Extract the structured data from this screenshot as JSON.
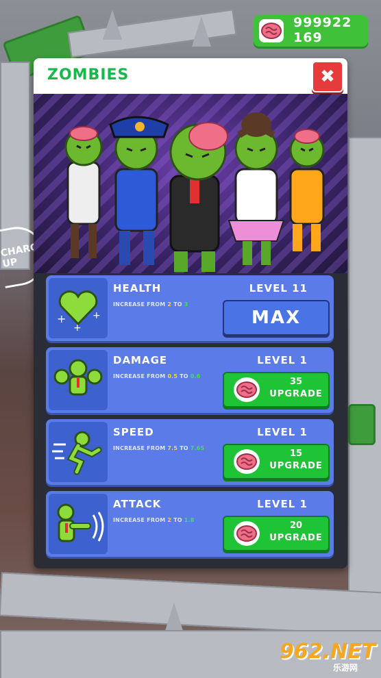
{
  "currency": {
    "brains": "999922",
    "second": "169"
  },
  "panel": {
    "title": "ZOMBIES",
    "close": "✖"
  },
  "upgrades": [
    {
      "name": "HEALTH",
      "desc_prefix": "INCREASE FROM ",
      "from": "2",
      "mid": " TO ",
      "to": "3",
      "level": "LEVEL 11",
      "button": "MAX"
    },
    {
      "name": "DAMAGE",
      "desc_prefix": "INCREASE FROM ",
      "from": "0.5",
      "mid": " TO ",
      "to": "0.6",
      "level": "LEVEL 1",
      "cost": "35",
      "button": "UPGRADE"
    },
    {
      "name": "SPEED",
      "desc_prefix": "INCREASE FROM ",
      "from": "7.5",
      "mid": " TO ",
      "to": "7.65",
      "level": "LEVEL 1",
      "cost": "15",
      "button": "UPGRADE"
    },
    {
      "name": "ATTACK",
      "desc_prefix": "INCREASE FROM ",
      "from": "2",
      "mid": " TO ",
      "to": "1.8",
      "level": "LEVEL 1",
      "cost": "20",
      "button": "UPGRADE"
    }
  ],
  "scene": {
    "sign_line1": "CHARG",
    "sign_line2": "UP"
  },
  "watermark": {
    "big": "962.NET",
    "small": "乐游网"
  },
  "colors": {
    "green": "#1ec435",
    "blue_row": "#5a7be8",
    "red_close": "#e53b3b",
    "title_green": "#18b84a"
  }
}
